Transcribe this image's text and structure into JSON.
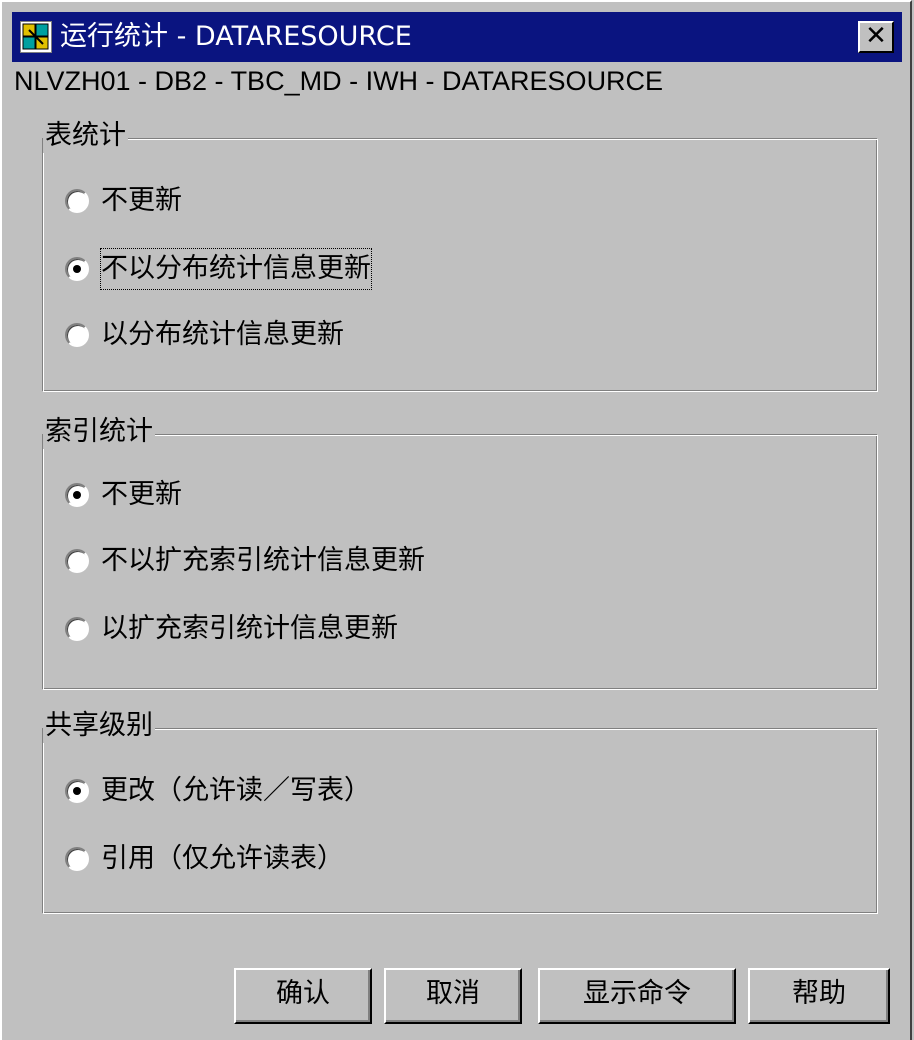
{
  "window": {
    "title": "运行统计 - DATARESOURCE",
    "close_label": "✕",
    "path": "NLVZH01 - DB2 - TBC_MD - IWH - DATARESOURCE"
  },
  "groups": {
    "table_stats": {
      "label": "表统计",
      "options": [
        "不更新",
        "不以分布统计信息更新",
        "以分布统计信息更新"
      ],
      "selected_index": 1
    },
    "index_stats": {
      "label": "索引统计",
      "options": [
        "不更新",
        "不以扩充索引统计信息更新",
        "以扩充索引统计信息更新"
      ],
      "selected_index": 0
    },
    "share_level": {
      "label": "共享级别",
      "options": [
        "更改（允许读／写表）",
        "引用（仅允许读表）"
      ],
      "selected_index": 0
    }
  },
  "buttons": {
    "ok": "确认",
    "cancel": "取消",
    "show_command": "显示命令",
    "help": "帮助"
  },
  "colors": {
    "titlebar": "#0a1480",
    "face": "#c0c0c0"
  }
}
